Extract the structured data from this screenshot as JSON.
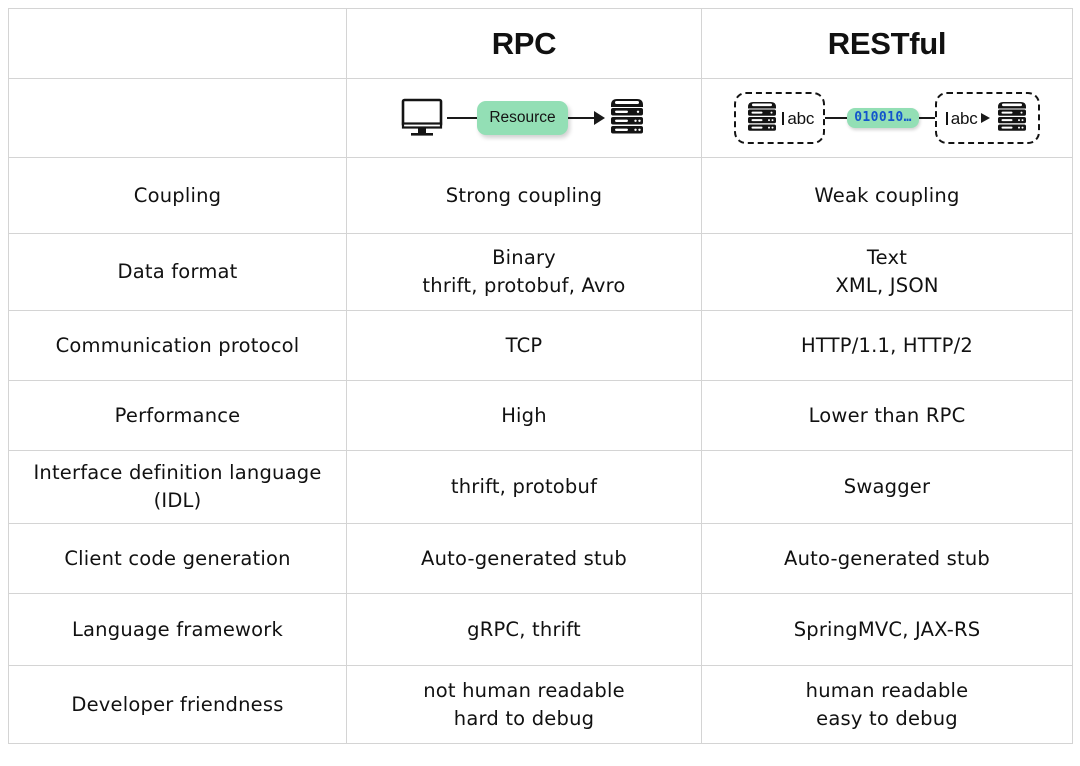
{
  "table": {
    "columns": {
      "label_header": "",
      "rpc_header": "RPC",
      "rest_header": "RESTful"
    },
    "diagrams": {
      "rpc": {
        "client_icon": "monitor-icon",
        "payload_label": "Resource",
        "server_icon": "server-icon"
      },
      "rest": {
        "source_server_icon": "server-icon",
        "source_format_label": "abc",
        "payload_label": "010010…",
        "target_format_label": "abc",
        "target_server_icon": "server-icon"
      }
    },
    "rows": [
      {
        "label": "Coupling",
        "rpc": [
          "Strong coupling"
        ],
        "rest": [
          "Weak coupling"
        ],
        "rpc_highlight": false,
        "rest_highlight": true
      },
      {
        "label": "Data format",
        "rpc": [
          "Binary",
          "thrift, protobuf, Avro"
        ],
        "rest": [
          "Text",
          "XML, JSON"
        ],
        "rpc_highlight": false,
        "rest_highlight": false
      },
      {
        "label": "Communication protocol",
        "rpc": [
          "TCP"
        ],
        "rest": [
          "HTTP/1.1, HTTP/2"
        ],
        "rpc_highlight": false,
        "rest_highlight": false
      },
      {
        "label": "Performance",
        "rpc": [
          "High"
        ],
        "rest": [
          "Lower than RPC"
        ],
        "rpc_highlight": true,
        "rest_highlight": false
      },
      {
        "label": "Interface definition language (IDL)",
        "label_lines": [
          "Interface definition language",
          "(IDL)"
        ],
        "rpc": [
          "thrift, protobuf"
        ],
        "rest": [
          "Swagger"
        ],
        "rpc_highlight": false,
        "rest_highlight": false
      },
      {
        "label": "Client code generation",
        "rpc": [
          "Auto-generated stub"
        ],
        "rest": [
          "Auto-generated stub"
        ],
        "rpc_highlight": false,
        "rest_highlight": false
      },
      {
        "label": "Language framework",
        "rpc": [
          "gRPC, thrift"
        ],
        "rest": [
          "SpringMVC, JAX-RS"
        ],
        "rpc_highlight": false,
        "rest_highlight": false
      },
      {
        "label": "Developer friendness",
        "rpc": [
          "not human readable",
          "hard to debug"
        ],
        "rest": [
          "human readable",
          "easy to debug"
        ],
        "rpc_highlight": false,
        "rest_highlight": true
      }
    ]
  },
  "colors": {
    "highlight_pink": "#fbc2fb",
    "accent_green": "#93dfb5",
    "binary_blue": "#1255cc",
    "grid_line": "#d4d4d4",
    "text": "#111111"
  },
  "cells": {
    "r0_label": "Coupling",
    "r0_rpc_l1": "Strong coupling",
    "r0_rest_l1": "Weak coupling",
    "r1_label": "Data format",
    "r1_rpc_l1": "Binary",
    "r1_rpc_l2": "thrift, protobuf, Avro",
    "r1_rest_l1": "Text",
    "r1_rest_l2": "XML, JSON",
    "r2_label": "Communication protocol",
    "r2_rpc_l1": "TCP",
    "r2_rest_l1": "HTTP/1.1, HTTP/2",
    "r3_label": "Performance",
    "r3_rpc_l1": "High",
    "r3_rest_l1": "Lower than RPC",
    "r4_label_l1": "Interface definition language",
    "r4_label_l2": "(IDL)",
    "r4_rpc_l1": "thrift, protobuf",
    "r4_rest_l1": "Swagger",
    "r5_label": "Client code generation",
    "r5_rpc_l1": "Auto-generated stub",
    "r5_rest_l1": "Auto-generated stub",
    "r6_label": "Language framework",
    "r6_rpc_l1": "gRPC, thrift",
    "r6_rest_l1": "SpringMVC, JAX-RS",
    "r7_label": "Developer friendness",
    "r7_rpc_l1": "not human readable",
    "r7_rpc_l2": "hard to debug",
    "r7_rest_l1": "human readable",
    "r7_rest_l2": "easy to debug"
  }
}
